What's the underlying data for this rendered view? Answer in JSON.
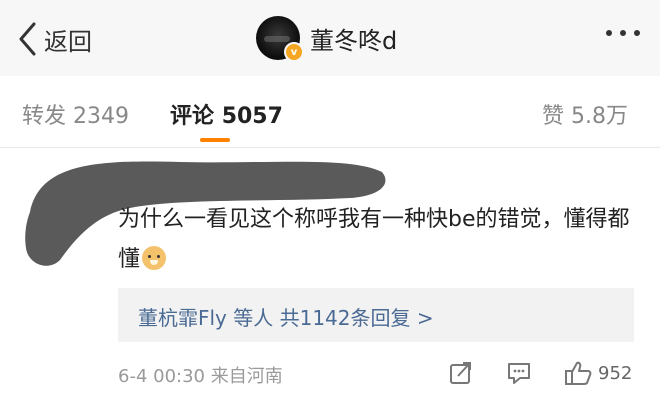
{
  "header": {
    "back_label": "返回",
    "user_name": "董冬咚d",
    "verified_badge": "v"
  },
  "tabs": [
    {
      "label": "转发",
      "count": "2349",
      "active": false
    },
    {
      "label": "评论",
      "count": "5057",
      "active": true
    },
    {
      "label": "赞",
      "count": "5.8万",
      "active": false
    }
  ],
  "comment": {
    "text": "为什么一看见这个称呼我有一种快be的错觉，懂得都懂",
    "emoji": "doge-emoji",
    "replies_label": "董杭霏Fly 等人  共1142条回复 >",
    "timestamp": "6-4 00:30",
    "source": "来自河南",
    "likes": "952"
  },
  "colors": {
    "accent": "#ff8200",
    "link": "#4a6a94",
    "redaction": "#5a5a5a"
  }
}
